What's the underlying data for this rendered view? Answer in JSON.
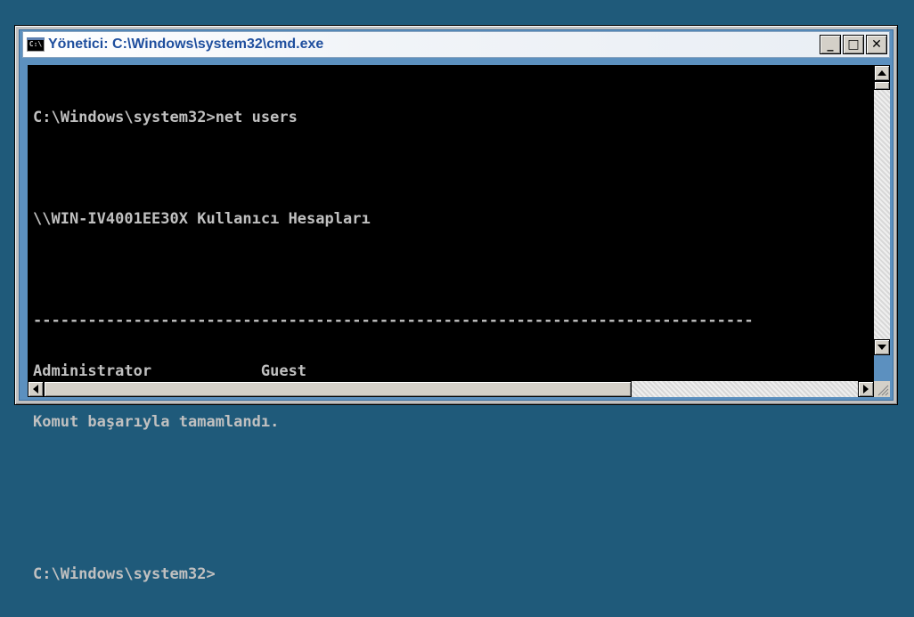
{
  "window": {
    "title": "Yönetici: C:\\Windows\\system32\\cmd.exe",
    "icon": "cmd-icon",
    "icon_text": "C:\\",
    "buttons": {
      "minimize": "_",
      "maximize": "□",
      "close": "✕"
    }
  },
  "console": {
    "lines": [
      "C:\\Windows\\system32>net users",
      "",
      "\\\\WIN-IV4001EE30X Kullanıcı Hesapları",
      "",
      "-------------------------------------------------------------------------------",
      "Administrator            Guest",
      "Komut başarıyla tamamlandı.",
      "",
      "",
      "C:\\Windows\\system32>"
    ]
  },
  "colors": {
    "desktop": "#1f5a7a",
    "console_bg": "#000000",
    "console_fg": "#c0c0c0",
    "title_text": "#1f4f9e"
  }
}
